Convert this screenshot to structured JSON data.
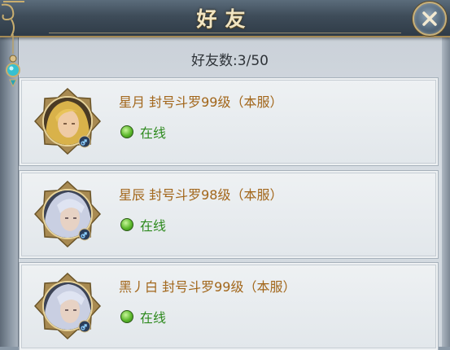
{
  "dialog": {
    "title": "好友",
    "count_label": "好友数:3/50",
    "close_icon": "close-icon"
  },
  "friends": [
    {
      "name": "星月 封号斗罗99级（本服）",
      "status": "在线",
      "gender_icon": "male-icon",
      "portrait": "blonde-hair-portrait"
    },
    {
      "name": "星辰 封号斗罗98级（本服）",
      "status": "在线",
      "gender_icon": "male-icon",
      "portrait": "silver-hair-portrait"
    },
    {
      "name": "黑丿白 封号斗罗99级（本服）",
      "status": "在线",
      "gender_icon": "male-icon",
      "portrait": "silver-hair-portrait"
    }
  ],
  "colors": {
    "name": "#a2661a",
    "online": "#2e8a1e",
    "gold_frame": "#c7b07a"
  }
}
